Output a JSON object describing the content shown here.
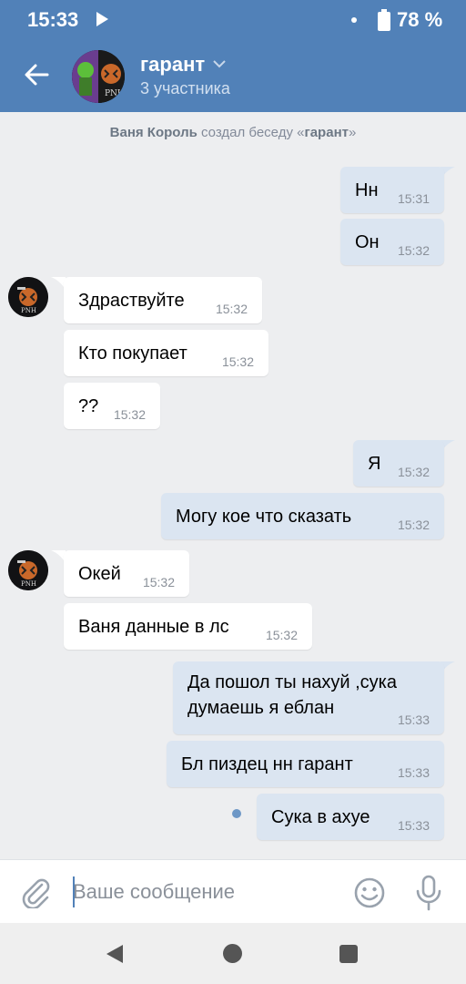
{
  "status_bar": {
    "time": "15:33",
    "battery": "78 %"
  },
  "header": {
    "title": "гарант",
    "subtitle": "3 участника",
    "colors": {
      "header_bg": "#5181b8"
    }
  },
  "system_message": {
    "author": "Ваня Король",
    "text": " создал беседу «",
    "chat": "гарант",
    "close": "»"
  },
  "messages": [
    {
      "dir": "out",
      "text": "Нн",
      "time": "15:31"
    },
    {
      "dir": "out",
      "text": "Он",
      "time": "15:32"
    },
    {
      "dir": "in",
      "text": "Здраствуйте",
      "time": "15:32"
    },
    {
      "dir": "in",
      "text": "Кто покупает",
      "time": "15:32"
    },
    {
      "dir": "in",
      "text": "??",
      "time": "15:32"
    },
    {
      "dir": "out",
      "text": "Я",
      "time": "15:32"
    },
    {
      "dir": "out",
      "text": "Могу кое что сказать",
      "time": "15:32"
    },
    {
      "dir": "in",
      "text": "Окей",
      "time": "15:32"
    },
    {
      "dir": "in",
      "text": "Ваня данные в лс",
      "time": "15:32"
    },
    {
      "dir": "out",
      "text": "Да пошол ты нахуй ,сука\nдумаешь я еблан",
      "time": "15:33"
    },
    {
      "dir": "out",
      "text": "Бл пиздец нн гарант",
      "time": "15:33"
    },
    {
      "dir": "out",
      "text": "Сука в ахуе",
      "time": "15:33",
      "unread": true
    }
  ],
  "input": {
    "placeholder": "Ваше сообщение",
    "value": ""
  },
  "icons": [
    "back-arrow-icon",
    "chevron-down-icon",
    "attach-icon",
    "emoji-icon",
    "microphone-icon",
    "nav-back-icon",
    "nav-home-icon",
    "nav-recent-icon"
  ]
}
